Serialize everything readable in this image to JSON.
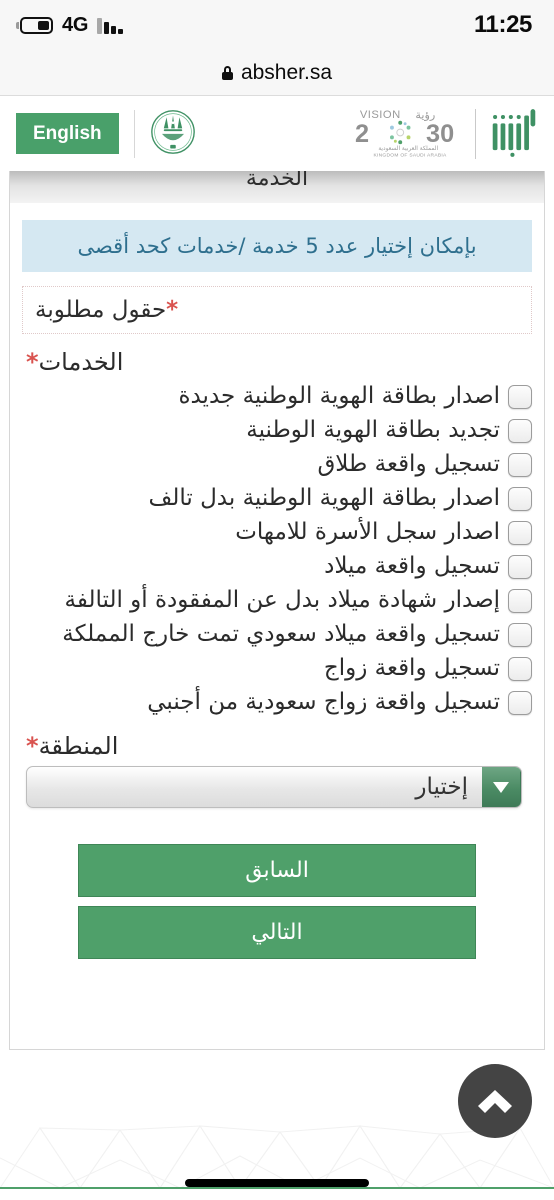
{
  "status_bar": {
    "network": "4G",
    "time": "11:25",
    "battery_icon": "battery-icon",
    "signal_icon": "signal-bars-icon"
  },
  "browser": {
    "lock_icon": "lock-icon",
    "url": "absher.sa"
  },
  "site_header": {
    "language_button": "English",
    "moi_emblem": "ministry-of-interior-emblem",
    "vision_logo": {
      "name": "vision-2030-logo",
      "word_mark": "VISION",
      "word_mark_ar": "رؤية",
      "year": "2030",
      "kingdom_ar": "المملكة العربية السعودية",
      "kingdom_en": "KINGDOM OF SAUDI ARABIA"
    },
    "absher_logo": "absher-logo"
  },
  "form": {
    "step_title": "الخدمة",
    "info_banner": "بإمكان إختيار عدد 5 خدمة /خدمات كحد أقصى",
    "required_note_star": "*",
    "required_note": "حقول مطلوبة",
    "services_label": "الخدمات",
    "services_label_star": "*",
    "services": [
      {
        "label": "اصدار بطاقة الهوية الوطنية جديدة",
        "checked": false
      },
      {
        "label": "تجديد بطاقة الهوية الوطنية",
        "checked": false
      },
      {
        "label": "تسجيل واقعة طلاق",
        "checked": false
      },
      {
        "label": "اصدار بطاقة الهوية الوطنية بدل تالف",
        "checked": false
      },
      {
        "label": "اصدار سجل الأسرة للامهات",
        "checked": false
      },
      {
        "label": "تسجيل واقعة ميلاد",
        "checked": false
      },
      {
        "label": "إصدار شهادة ميلاد بدل عن المفقودة أو التالفة",
        "checked": false
      },
      {
        "label": "تسجيل واقعة ميلاد سعودي تمت خارج المملكة",
        "checked": false
      },
      {
        "label": "تسجيل واقعة زواج",
        "checked": false
      },
      {
        "label": "تسجيل واقعة زواج سعودية من أجنبي",
        "checked": false
      }
    ],
    "region_label": "المنطقة",
    "region_label_star": "*",
    "region_selected": "إختيار",
    "region_dropdown_icon": "chevron-down-icon",
    "button_previous": "السابق",
    "button_next": "التالي"
  },
  "floating": {
    "scroll_top_icon": "chevron-up-icon"
  },
  "colors": {
    "brand_green": "#4fa06a",
    "info_bg": "#d5e8f2",
    "info_text": "#2e6f8e",
    "required_red": "#d9534f",
    "fab_dark": "#444444"
  }
}
